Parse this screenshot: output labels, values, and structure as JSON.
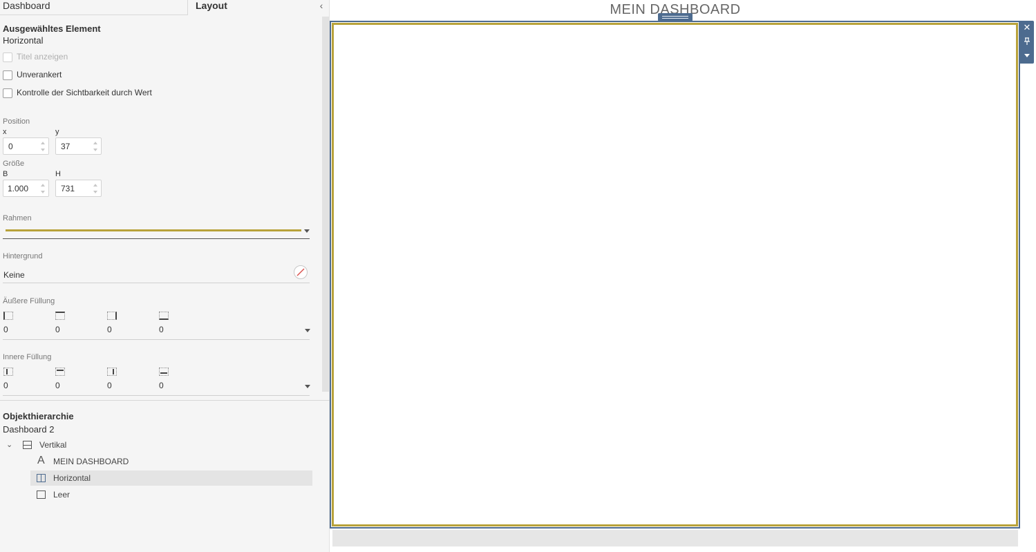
{
  "tabs": {
    "dashboard": "Dashboard",
    "layout": "Layout"
  },
  "selected": {
    "heading": "Ausgewähltes Element",
    "name": "Horizontal"
  },
  "checkboxes": {
    "show_title": "Titel anzeigen",
    "floating": "Unverankert",
    "visibility": "Kontrolle der Sichtbarkeit durch Wert"
  },
  "position": {
    "label": "Position",
    "x_label": "x",
    "y_label": "y",
    "x": "0",
    "y": "37"
  },
  "size": {
    "label": "Größe",
    "w_label": "B",
    "h_label": "H",
    "w": "1.000",
    "h": "731"
  },
  "border": {
    "label": "Rahmen",
    "color": "#b8a23a"
  },
  "background": {
    "label": "Hintergrund",
    "value": "Keine"
  },
  "outer_padding": {
    "label": "Äußere Füllung",
    "left": "0",
    "top": "0",
    "right": "0",
    "bottom": "0"
  },
  "inner_padding": {
    "label": "Innere Füllung",
    "left": "0",
    "top": "0",
    "right": "0",
    "bottom": "0"
  },
  "hierarchy": {
    "heading": "Objekthierarchie",
    "dashboard": "Dashboard 2",
    "items": [
      {
        "label": "Vertikal",
        "icon": "vertical-container-icon"
      },
      {
        "label": "MEIN DASHBOARD",
        "icon": "text-icon"
      },
      {
        "label": "Horizontal",
        "icon": "horizontal-container-icon"
      },
      {
        "label": "Leer",
        "icon": "blank-icon"
      }
    ]
  },
  "canvas": {
    "title": "MEIN DASHBOARD"
  },
  "colors": {
    "accent": "#4d6b8f",
    "border_gold": "#b8a23a",
    "selected_row": "#e4e4e4"
  }
}
